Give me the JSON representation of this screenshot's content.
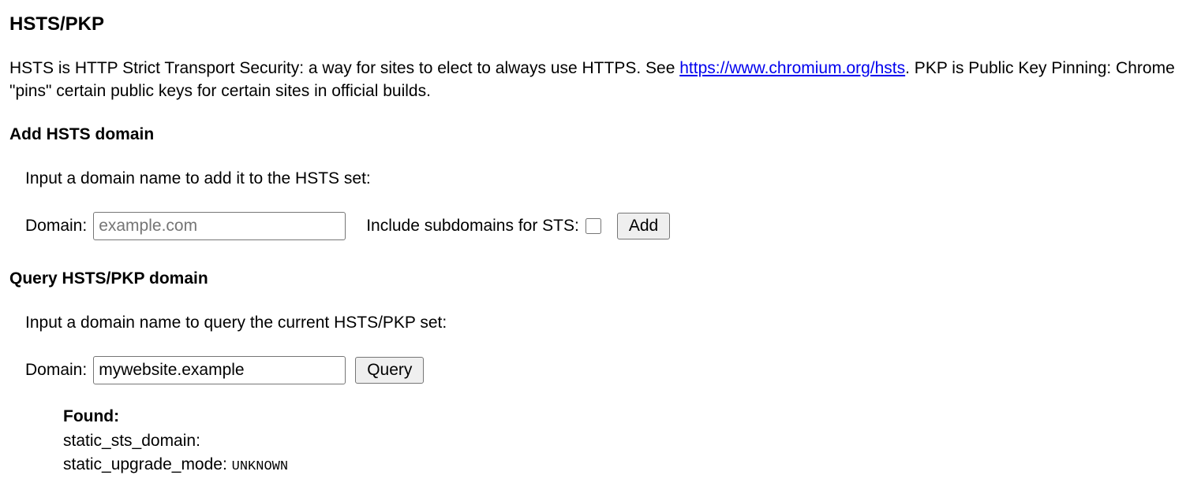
{
  "page_title": "HSTS/PKP",
  "intro_before_link": "HSTS is HTTP Strict Transport Security: a way for sites to elect to always use HTTPS. See ",
  "intro_link_text": "https://www.chromium.org/hsts",
  "intro_after_link": ". PKP is Public Key Pinning: Chrome \"pins\" certain public keys for certain sites in official builds.",
  "add": {
    "heading": "Add HSTS domain",
    "prompt": "Input a domain name to add it to the HSTS set:",
    "domain_label": "Domain:",
    "placeholder": "example.com",
    "value": "",
    "include_sub_label": "Include subdomains for STS:",
    "button": "Add"
  },
  "query": {
    "heading": "Query HSTS/PKP domain",
    "prompt": "Input a domain name to query the current HSTS/PKP set:",
    "domain_label": "Domain:",
    "value": "mywebsite.example",
    "button": "Query"
  },
  "results": {
    "found_label": "Found:",
    "lines": [
      {
        "key": "static_sts_domain:",
        "val": ""
      },
      {
        "key": "static_upgrade_mode: ",
        "val": "UNKNOWN"
      }
    ]
  }
}
